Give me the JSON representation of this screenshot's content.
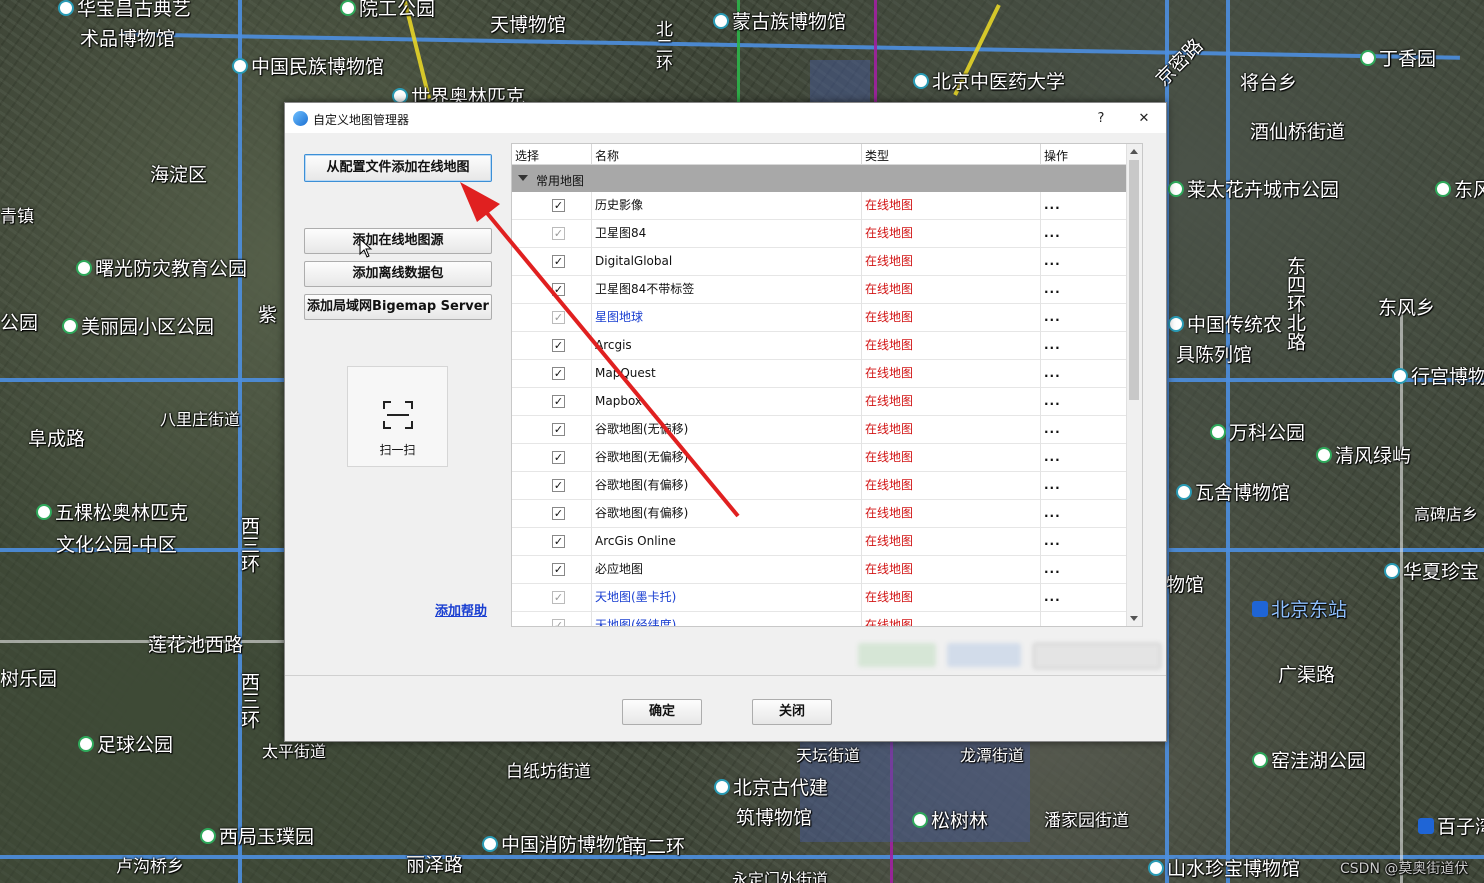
{
  "map": {
    "labels": {
      "l1": "华宝昌古典艺",
      "l2": "术品博物馆",
      "l3": "院工公园",
      "l4": "天博物馆",
      "l5": "蒙古族博物馆",
      "l6": "中国民族博物馆",
      "l7": "世界奥林匹克",
      "l8": "北京中医药大学",
      "l9": "丁香园",
      "l10": "将台乡",
      "l11": "海淀区",
      "l12": "酒仙桥街道",
      "l13": "莱太花卉城市公园",
      "l14": "东风",
      "l15": "曙光防灾教育公园",
      "l16": "美丽园小区公园",
      "l17": "东风乡",
      "l18": "中国传统农",
      "l19": "具陈列馆",
      "l20": "行宫博物",
      "l21": "八里庄街道",
      "l22": "阜成路",
      "l23": "万科公园",
      "l24": "清风绿屿",
      "l25": "五棵松奥林匹克",
      "l26": "文化公园-中区",
      "l27": "瓦舍博物馆",
      "l28": "高碑店乡",
      "l29": "华夏珍宝",
      "l30": "北京东站",
      "l31": "莲花池西路",
      "l32": "树乐园",
      "l33": "广渠路",
      "l34": "足球公园",
      "l35": "天坛街道",
      "l36": "龙潭街道",
      "l37": "窑洼湖公园",
      "l38": "白纸坊街道",
      "l39": "北京古代建",
      "l40": "筑博物馆",
      "l41": "松树林",
      "l42": "潘家园街道",
      "l43": "西局玉璞园",
      "l44": "中国消防博物馆",
      "l45": "南二环",
      "l46": "丽泽路",
      "l47": "卢沟桥乡",
      "l48": "永定门外街道",
      "l49": "山水珍宝博物馆",
      "l50": "百子湾",
      "l51": "西三环",
      "l52": "东四环北路",
      "l53": "京密路",
      "l54": "物馆",
      "l55": "公园",
      "l56": "青镇",
      "l57": "紫",
      "l58": "太平街道",
      "l59": "西三环",
      "l60": "北二环",
      "l61": "CSDN @莫奥街道伏"
    }
  },
  "dialog": {
    "title": "自定义地图管理器",
    "help_btn": "?",
    "close_btn": "✕",
    "buttons": {
      "add_from_config": "从配置文件添加在线地图",
      "add_online_source": "添加在线地图源",
      "add_offline_pack": "添加离线数据包",
      "add_lan_server": "添加局域网Bigemap Server"
    },
    "scan_label": "扫一扫",
    "help_link": "添加帮助",
    "table": {
      "headers": [
        "选择",
        "名称",
        "类型",
        "操作"
      ],
      "group": "常用地图",
      "rows": [
        {
          "name": "历史影像",
          "type": "在线地图",
          "ops": "...",
          "checked": "✓",
          "blue": false,
          "dim": false
        },
        {
          "name": "卫星图84",
          "type": "在线地图",
          "ops": "...",
          "checked": "✓",
          "blue": false,
          "dim": true
        },
        {
          "name": "DigitalGlobal",
          "type": "在线地图",
          "ops": "...",
          "checked": "✓",
          "blue": false,
          "dim": false
        },
        {
          "name": "卫星图84不带标签",
          "type": "在线地图",
          "ops": "...",
          "checked": "✓",
          "blue": false,
          "dim": false
        },
        {
          "name": "星图地球",
          "type": "在线地图",
          "ops": "...",
          "checked": "✓",
          "blue": true,
          "dim": true
        },
        {
          "name": "Arcgis",
          "type": "在线地图",
          "ops": "...",
          "checked": "✓",
          "blue": false,
          "dim": false
        },
        {
          "name": "MapQuest",
          "type": "在线地图",
          "ops": "...",
          "checked": "✓",
          "blue": false,
          "dim": false
        },
        {
          "name": "Mapbox",
          "type": "在线地图",
          "ops": "...",
          "checked": "✓",
          "blue": false,
          "dim": false
        },
        {
          "name": "谷歌地图(无偏移)",
          "type": "在线地图",
          "ops": "...",
          "checked": "✓",
          "blue": false,
          "dim": false
        },
        {
          "name": "谷歌地图(无偏移)",
          "type": "在线地图",
          "ops": "...",
          "checked": "✓",
          "blue": false,
          "dim": false
        },
        {
          "name": "谷歌地图(有偏移)",
          "type": "在线地图",
          "ops": "...",
          "checked": "✓",
          "blue": false,
          "dim": false
        },
        {
          "name": "谷歌地图(有偏移)",
          "type": "在线地图",
          "ops": "...",
          "checked": "✓",
          "blue": false,
          "dim": false
        },
        {
          "name": "ArcGis Online",
          "type": "在线地图",
          "ops": "...",
          "checked": "✓",
          "blue": false,
          "dim": false
        },
        {
          "name": "必应地图",
          "type": "在线地图",
          "ops": "...",
          "checked": "✓",
          "blue": false,
          "dim": false
        },
        {
          "name": "天地图(墨卡托)",
          "type": "在线地图",
          "ops": "...",
          "checked": "✓",
          "blue": true,
          "dim": true
        },
        {
          "name": "天地图(经纬度)",
          "type": "在线地图",
          "ops": "",
          "checked": "✓",
          "blue": true,
          "dim": true
        }
      ]
    },
    "ok": "确定",
    "close": "关闭"
  },
  "colors": {
    "accent": "#3c8fd6",
    "type_red": "#d21414",
    "link_blue": "#1a3fd1",
    "arrow_red": "#e02020"
  }
}
